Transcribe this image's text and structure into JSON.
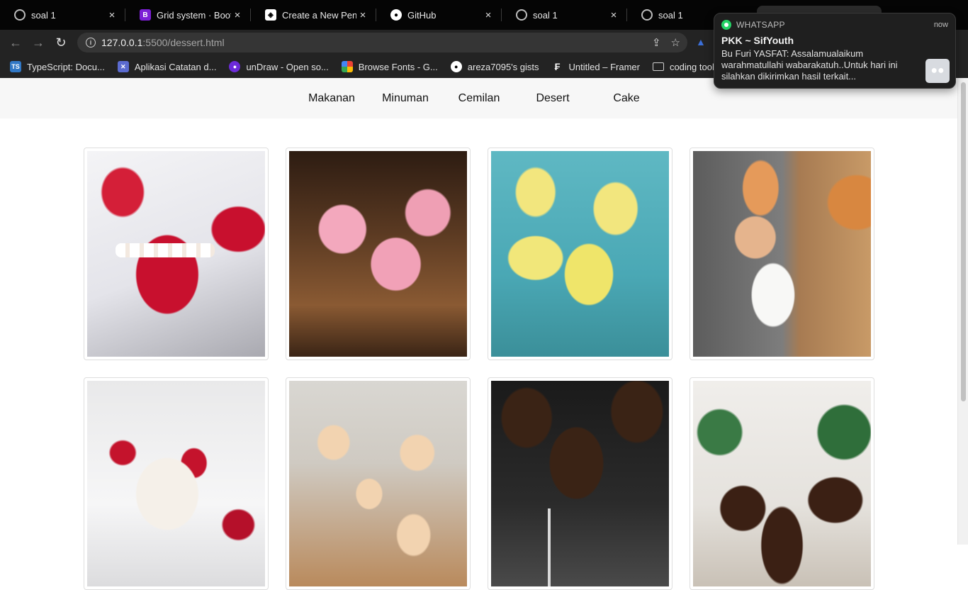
{
  "tabs": [
    {
      "title": "soal 1",
      "icon": "globe-icon",
      "close": "×"
    },
    {
      "title": "Grid system · Boots",
      "icon": "bootstrap-icon",
      "close": "×"
    },
    {
      "title": "Create a New Pen",
      "icon": "codepen-icon",
      "close": "×"
    },
    {
      "title": "GitHub",
      "icon": "github-icon",
      "close": "×"
    },
    {
      "title": "soal 1",
      "icon": "globe-icon",
      "close": "×"
    },
    {
      "title": "soal 1",
      "icon": "globe-icon",
      "close": ""
    }
  ],
  "toolbar": {
    "back": "←",
    "forward": "→",
    "reload": "↻",
    "url_host": "127.0.0.1",
    "url_path": ":5500/dessert.html",
    "share": "⇪",
    "star": "☆",
    "extension": "▲"
  },
  "bookmarks": [
    {
      "label": "TypeScript: Docu...",
      "icon": "typescript-icon",
      "glyph": "TS"
    },
    {
      "label": "Aplikasi Catatan d...",
      "icon": "app-icon",
      "glyph": "✕"
    },
    {
      "label": "unDraw - Open so...",
      "icon": "undraw-icon",
      "glyph": "●"
    },
    {
      "label": "Browse Fonts - G...",
      "icon": "google-fonts-icon",
      "glyph": ""
    },
    {
      "label": "areza7095's gists",
      "icon": "github-icon",
      "glyph": "●"
    },
    {
      "label": "Untitled – Framer",
      "icon": "framer-icon",
      "glyph": "₣"
    },
    {
      "label": "coding tools",
      "icon": "folder-icon",
      "glyph": ""
    }
  ],
  "nav": {
    "links": [
      "Makanan",
      "Minuman",
      "Cemilan",
      "Desert",
      "Cake"
    ]
  },
  "gallery": [
    {
      "name": "red-velvet-cakes-photo"
    },
    {
      "name": "raspberry-mousse-photo"
    },
    {
      "name": "lemon-cheesecake-jars-photo"
    },
    {
      "name": "peach-panna-cotta-photo"
    },
    {
      "name": "berry-panna-cotta-photo"
    },
    {
      "name": "lotus-biscoff-truffles-photo"
    },
    {
      "name": "chocolate-mousse-photo"
    },
    {
      "name": "christmas-chocolate-cakes-photo"
    }
  ],
  "notification": {
    "app": "WHATSAPP",
    "time": "now",
    "title": "PKK ~ SifYouth",
    "body": "Bu Furi YASFAT: Assalamualaikum warahmatullahi wabarakatuh..Untuk hari ini silahkan dikirimkan hasil terkait...",
    "accent_color": "#25d366",
    "group_icon": "group-avatar-icon"
  }
}
